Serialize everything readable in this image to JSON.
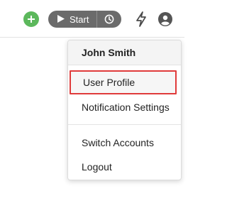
{
  "toolbar": {
    "add_icon": "plus-icon",
    "start_label": "Start",
    "play_icon": "play-icon",
    "clock_icon": "clock-icon",
    "bolt_icon": "bolt-icon",
    "user_icon": "user-circle-icon"
  },
  "user_menu": {
    "user_name": "John Smith",
    "items": [
      {
        "label": "User Profile",
        "highlighted": true
      },
      {
        "label": "Notification Settings"
      },
      {
        "label": "Switch Accounts"
      },
      {
        "label": "Logout"
      }
    ]
  },
  "colors": {
    "add_button": "#5cb85c",
    "timer_button": "#6b6b6b",
    "highlight_border": "#e03b3b"
  }
}
